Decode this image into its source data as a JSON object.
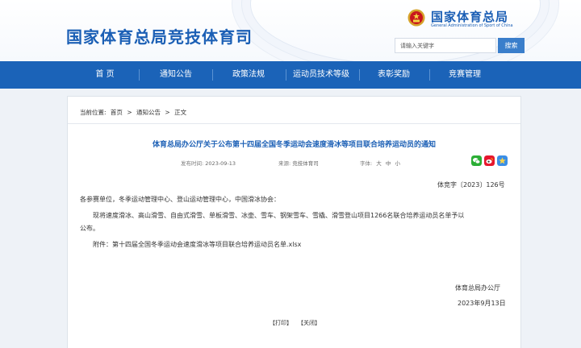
{
  "header": {
    "site_title": "国家体育总局竞技体育司",
    "agency_name": "国家体育总局",
    "agency_english": "General Administration of Sport of China",
    "search": {
      "placeholder": "请输入关键字",
      "button_label": "搜索"
    }
  },
  "nav": {
    "items": [
      {
        "label": "首 页"
      },
      {
        "label": "通知公告"
      },
      {
        "label": "政策法规"
      },
      {
        "label": "运动员技术等级"
      },
      {
        "label": "表彰奖励"
      },
      {
        "label": "竞赛管理"
      }
    ]
  },
  "breadcrumb": {
    "prefix": "当前位置:",
    "items": [
      "首页",
      "通知公告",
      "正文"
    ],
    "separator": ">"
  },
  "article": {
    "title": "体育总局办公厅关于公布第十四届全国冬季运动会速度滑冰等项目联合培养运动员的通知",
    "meta": {
      "date_label": "发布时间:",
      "date_value": "2023-09-13",
      "source_label": "来源:",
      "source_value": "竞技体育司",
      "font_label": "字体:",
      "font_sizes": [
        "大",
        "中",
        "小"
      ]
    },
    "share_icons": [
      "wechat-icon",
      "weibo-icon",
      "favorite-icon"
    ],
    "doc_number": "体竞字〔2023〕126号",
    "recipients": "各参赛单位，冬季运动管理中心、登山运动管理中心，中国滑冰协会：",
    "body_line_1": "现将速度滑冰、高山滑雪、自由式滑雪、单板滑雪、冰壶、雪车、钢架雪车、雪橇、滑雪登山项目1266名联合培养运动员名单予以",
    "body_line_2": "公布。",
    "attachment": "附件：第十四届全国冬季运动会速度滑冰等项目联合培养运动员名单.xlsx",
    "signature_org": "体育总局办公厅",
    "signature_date": "2023年9月13日",
    "actions": {
      "print": "【打印】",
      "close": "【关闭】"
    }
  },
  "colors": {
    "brand_blue": "#1b5fb5",
    "nav_blue": "#1b63b8",
    "search_button": "#3a7ecb",
    "page_bg": "#eef2f7"
  }
}
